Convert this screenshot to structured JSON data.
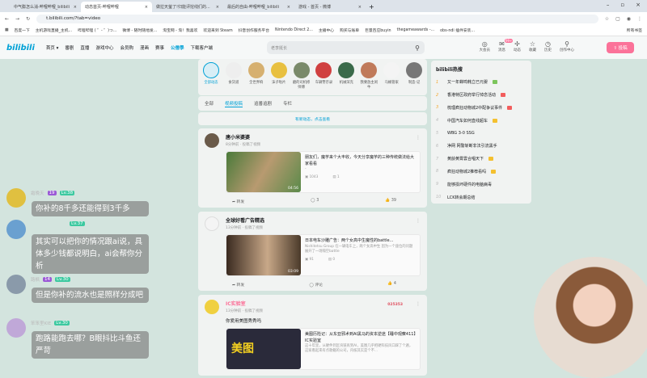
{
  "browser": {
    "tabs": [
      {
        "title": "中气膨怎么消-哔哩哔哩_bilibili"
      },
      {
        "title": "动态首页-哔哩哔哩",
        "active": true
      },
      {
        "title": "做拉天萤了!归能评挖线们的..."
      },
      {
        "title": "最后的自由-哔哩哔哩_bilibili"
      },
      {
        "title": "游戏 - 首页 - 微博"
      }
    ],
    "url": "t.bilibili.com/?tab=video",
    "bookmarks": [
      "百度一下",
      "主机游戏直播_主机...",
      "哔哩哔哩 ( ゜- ゜)つ...",
      "微博 - 随时随地发...",
      "淘宝网 - 淘！我喜欢",
      "欢迎来到 Steam",
      "抖音创作服务平台",
      "Nintendo Direct 2...",
      "主播中心",
      "购买与账单",
      "巨量百应buyin",
      "thegameawards -...",
      "obs-ndi 插件安装..."
    ],
    "all_bookmarks": "所有书签"
  },
  "header": {
    "logo": "bilibili",
    "nav": [
      "首页 ▾",
      "番剧",
      "直播",
      "游戏中心",
      "会员购",
      "漫画",
      "赛事",
      "公僧學",
      "下载客户端"
    ],
    "search_placeholder": "老李挺长",
    "right": [
      {
        "icon": "◎",
        "label": "大会员"
      },
      {
        "icon": "✉",
        "label": "消息",
        "badge": "99+"
      },
      {
        "icon": "✢",
        "label": "动态"
      },
      {
        "icon": "☆",
        "label": "收藏"
      },
      {
        "icon": "◷",
        "label": "历史"
      },
      {
        "icon": "⚲",
        "label": "创作中心"
      }
    ],
    "upload": "⇧ 投稿"
  },
  "ups": [
    "全部动态",
    "食货道",
    "全世界响",
    "沫子啦片",
    "磨的司机修师傅",
    "车辆警示录",
    "机械深克",
    "我要放主闲牛",
    "马桶管家",
    "制造-记"
  ],
  "filters": [
    "全部",
    "视频投稿",
    "追番追剧",
    "专栏"
  ],
  "new_notice": "有新动态，点击查看",
  "posts": [
    {
      "name": "唐小米婆婆",
      "meta": "8分钟前 · 投稿了视频",
      "title": "朋友们，魔芋来个大丰收，今天分享魔芋的三种传统做法给大家看看",
      "desc": "-",
      "duration": "04:56",
      "views": "1043",
      "danmaku": "1",
      "share": "转发",
      "comments": "3",
      "likes": "39"
    },
    {
      "name": "全球好看广告精选",
      "meta": "13分钟前 · 投稿了视频",
      "title": "日本电车沙雕广告：两个女高中生魔性的battle...",
      "desc": "Nishitetsu Group 在一辆电车上，两个女高中生 因为一个座位的问题展开了一场隔空battle",
      "duration": "03:09",
      "views": "91",
      "danmaku": "0",
      "share": "转发",
      "comments": "评论",
      "likes": "4"
    },
    {
      "name": "IC实验室",
      "meta": "13分钟前 · 投稿了视频",
      "text": "你爱用美图秀秀吗",
      "badge_num": "025353",
      "title": "美图历险记：从东亚邪术到AI黑马的资本逆途【睡中观察411】IC实验室",
      "desc": "这十年里，从硬件到区块链再到AI，美图几乎把硬科技风口踩了个遍，这家看起来有点歌籍的公司，内核其实是个不...",
      "thumb_text": "美图"
    }
  ],
  "hot": {
    "title": "bilibili热搜",
    "items": [
      "又一年蝉鸣韩立已元婴",
      "香港特区政府举行悼念活动",
      "梳理疯狂动物城2中配争议事件",
      "中国汽车如何直线超车",
      "WBG 3-0 SSG",
      "净网 网警斩断非法引流黑手",
      "黄龄黄霄雲合唱天下",
      "疯狂动物城2推荐看吗",
      "能够损坏硬件的电脑病毒",
      "LCK转会期总结"
    ]
  },
  "chat": [
    {
      "user": "霜晚天",
      "fan": "19",
      "lv": "Lv.38",
      "msg": "你补的8千多还能得到3千多"
    },
    {
      "user": "",
      "lv": "Lv.37",
      "msg": "其实可以把你的情况跟ai说，具体多少钱都说明白，ai会帮你分析"
    },
    {
      "user": "路枫",
      "fan": "14",
      "lv": "Lv.30",
      "msg": "但是你补的流水也是照样分成吧"
    },
    {
      "user": "笨笨里KIE",
      "lv": "Lv.30",
      "msg": "跑路能跑去哪？B眼抖比斗鱼还严苛"
    }
  ]
}
